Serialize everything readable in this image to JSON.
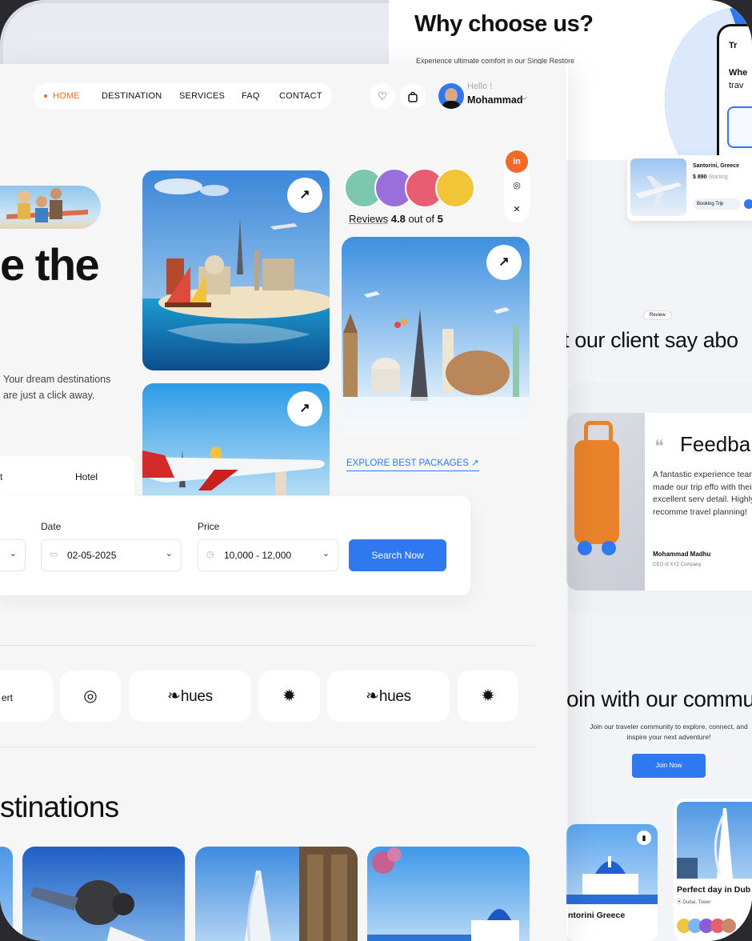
{
  "colors": {
    "accent": "#f06a2a",
    "primary": "#2f78f0",
    "background": "#f6f6f7"
  },
  "back": {
    "why_title": "Why choose us?",
    "why_subtitle": "Experience ultimate comfort in our Single Restore",
    "phone": {
      "line1": "Tr",
      "line2": "Whe",
      "line3": "trav"
    },
    "trip": {
      "name": "Santorini, Greece",
      "price": "$ 890",
      "price_label": "Starting",
      "button": "Booking Trip"
    },
    "review_pill": "Review",
    "client_title": "t our client say abo",
    "feedback": {
      "title": "Feedba",
      "text": "A fantastic experience team made our trip effo with their excellent serv detail. Highly recomme travel planning!",
      "author": "Mohammad Madhu",
      "role": "CEO of XYZ Company"
    },
    "community": {
      "title": "oin with our commu",
      "text": "Join our traveler community to explore, connect, and inspire your next adventure!",
      "button": "Join Now"
    },
    "gallery": [
      {
        "name": "ntorini Greece"
      },
      {
        "name": "Perfect day in Dub",
        "location": "Dubai, Tower"
      }
    ]
  },
  "nav": {
    "items": [
      {
        "label": "HOME",
        "active": true
      },
      {
        "label": "DESTINATION",
        "active": false
      },
      {
        "label": "SERVICES",
        "active": false
      },
      {
        "label": "FAQ",
        "active": false
      },
      {
        "label": "CONTACT",
        "active": false
      }
    ]
  },
  "user": {
    "greeting": "Hello !",
    "name": "Mohammad"
  },
  "hero": {
    "title": "e the",
    "subtitle": "Your dream destinations are just a click away."
  },
  "social": {
    "linkedin": "in",
    "instagram": "◎",
    "x": "✕"
  },
  "reviews": {
    "label": "Reviews",
    "score": "4.8",
    "suffix": "out of",
    "max": "5"
  },
  "explore": {
    "label": "EXPLORE BEST PACKAGES",
    "icon": "arrow-up-right"
  },
  "search": {
    "tab_partial": "t",
    "tab_hotel": "Hotel",
    "date_label": "Date",
    "date_value": "02-05-2025",
    "price_label": "Price",
    "price_value": "10,000 - 12,000",
    "button": "Search Now"
  },
  "logos": {
    "partial": "ert",
    "hues": "hues"
  },
  "destinations": {
    "title": "stinations"
  }
}
